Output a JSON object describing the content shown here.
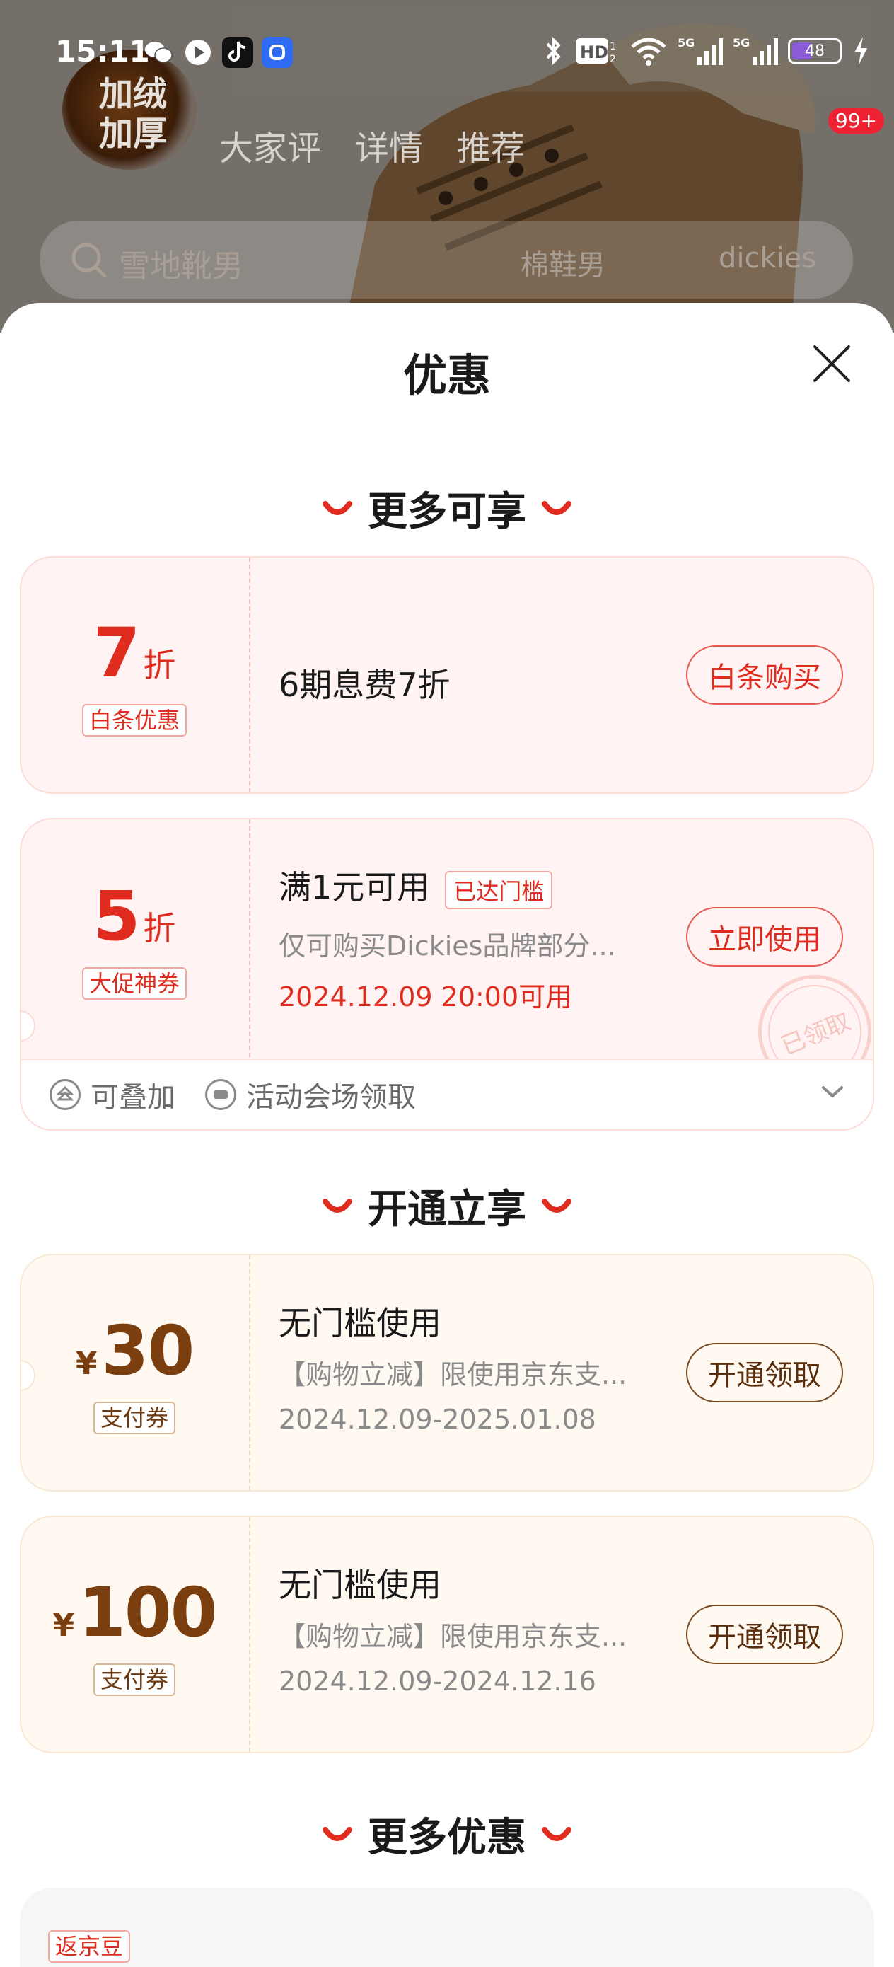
{
  "status_bar": {
    "time": "15:11",
    "battery": "48",
    "battery_level_percent": 48,
    "icons": [
      "wechat-icon",
      "video-icon",
      "tiktok-icon",
      "browser-icon",
      "bluetooth-icon",
      "hd-icon",
      "wifi-icon",
      "signal-5g-icon",
      "signal-5g-icon",
      "battery-icon",
      "charging-icon"
    ]
  },
  "background": {
    "badge_line1": "加绒",
    "badge_line2": "加厚",
    "tabs": [
      "大家评",
      "详情",
      "推荐"
    ],
    "message_count": "99+",
    "search_placeholder": "雪地靴男",
    "hot_words": [
      "棉鞋男",
      "dickies"
    ]
  },
  "sheet": {
    "title": "优惠",
    "sections": {
      "more_available": "更多可享",
      "open_enjoy": "开通立享",
      "more_offers": "更多优惠"
    },
    "colors": {
      "accent_red": "#e02b1f",
      "accent_brown": "#7a3e0f"
    },
    "coupons": [
      {
        "value": "7",
        "unit": "折",
        "tag": "白条优惠",
        "title": "6期息费7折",
        "button": "白条购买"
      },
      {
        "value": "5",
        "unit": "折",
        "tag": "大促神券",
        "title": "满1元可用",
        "badge": "已达门槛",
        "desc": "仅可购买Dickies品牌部分...",
        "time": "2024.12.09 20:00可用",
        "button": "立即使用",
        "stamp": "已领取",
        "footer_stackable": "可叠加",
        "footer_source": "活动会场领取"
      },
      {
        "currency": "¥",
        "value": "30",
        "tag": "支付券",
        "title": "无门槛使用",
        "desc": "【购物立减】限使用京东支...",
        "time": "2024.12.09-2025.01.08",
        "button": "开通领取"
      },
      {
        "currency": "¥",
        "value": "100",
        "tag": "支付券",
        "title": "无门槛使用",
        "desc": "【购物立减】限使用京东支...",
        "time": "2024.12.09-2024.12.16",
        "button": "开通领取"
      }
    ],
    "more_card_tag": "返京豆"
  }
}
